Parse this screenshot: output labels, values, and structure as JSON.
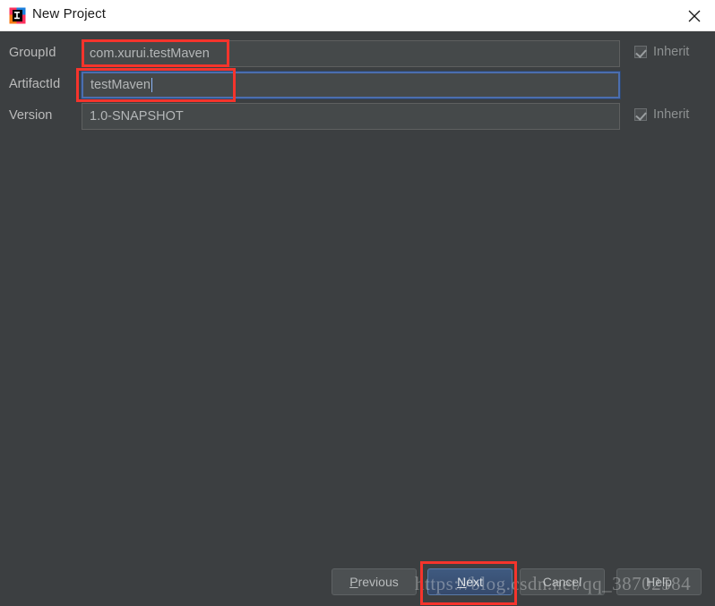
{
  "window": {
    "title": "New Project",
    "app_icon": "intellij-idea-icon",
    "close_icon": "close-icon",
    "background_color": "#3c3f41",
    "titlebar_color": "#ffffff"
  },
  "form": {
    "fields": [
      {
        "label": "GroupId",
        "value": "com.xurui.testMaven",
        "focused": false,
        "has_inherit": true,
        "inherit_label": "Inherit",
        "inherit_checked": true
      },
      {
        "label": "ArtifactId",
        "value": "testMaven",
        "focused": true,
        "has_inherit": false,
        "inherit_label": "",
        "inherit_checked": false
      },
      {
        "label": "Version",
        "value": "1.0-SNAPSHOT",
        "focused": false,
        "has_inherit": true,
        "inherit_label": "Inherit",
        "inherit_checked": true
      }
    ]
  },
  "footer": {
    "previous_label": "Previous",
    "previous_mnemonic": "P",
    "next_label": "Next",
    "next_mnemonic": "N",
    "cancel_label": "Cancel",
    "help_label": "Help"
  },
  "annotations": {
    "color": "#f5342c",
    "boxes": [
      "groupid-value",
      "artifactid-field",
      "next-button"
    ]
  },
  "watermark": {
    "text": "https://blog.csdn.net/qq_38702584"
  }
}
